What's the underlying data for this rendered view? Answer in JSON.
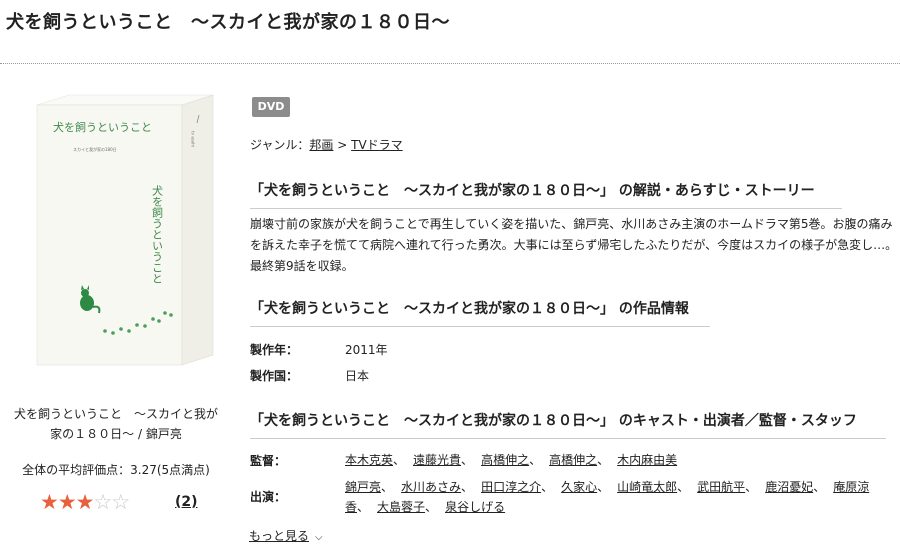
{
  "page": {
    "title": "犬を飼うということ　〜スカイと我が家の１８０日〜"
  },
  "cover": {
    "box_title": "犬を飼うということ",
    "spine_title": "犬を飼うということ",
    "box_subtitle": "スカイと我が家の180日",
    "brand": "tv asahi"
  },
  "product": {
    "name": "犬を飼うということ　〜スカイと我が家の１８０日〜 / 錦戸亮",
    "avg_rating_text": "全体の平均評価点：3.27(5点満点)",
    "rating": 3.27,
    "stars_filled": 3,
    "stars_total": 5,
    "review_count": "(2)"
  },
  "format_badge": "DVD",
  "genre": {
    "label": "ジャンル：",
    "link1": "邦画",
    "separator": " > ",
    "link2": "TVドラマ"
  },
  "sections": {
    "synopsis_heading": "「犬を飼うということ　〜スカイと我が家の１８０日〜」 の解説・あらすじ・ストーリー",
    "synopsis_text": "崩壊寸前の家族が犬を飼うことで再生していく姿を描いた、錦戸亮、水川あさみ主演のホームドラマ第5巻。お腹の痛みを訴えた幸子を慌てて病院へ連れて行った勇次。大事には至らず帰宅したふたりだが、今度はスカイの様子が急変し…。最終第9話を収録。",
    "info_heading": "「犬を飼うということ　〜スカイと我が家の１８０日〜」 の作品情報",
    "cast_heading": "「犬を飼うということ　〜スカイと我が家の１８０日〜」 のキャスト・出演者／監督・スタッフ"
  },
  "info": {
    "year_label": "製作年：",
    "year_value": "2011年",
    "country_label": "製作国：",
    "country_value": "日本"
  },
  "credits": {
    "director_label": "監督：",
    "directors": [
      "本木克英",
      "遠藤光貴",
      "高橋伸之",
      "高橋伸之",
      "木内麻由美"
    ],
    "cast_label": "出演：",
    "cast": [
      "錦戸亮",
      "水川あさみ",
      "田口淳之介",
      "久家心",
      "山崎竜太郎",
      "武田航平",
      "鹿沼憂妃",
      "庵原涼香",
      "大島蓉子",
      "泉谷しげる"
    ],
    "separator": "、"
  },
  "more_link": "もっと見る"
}
